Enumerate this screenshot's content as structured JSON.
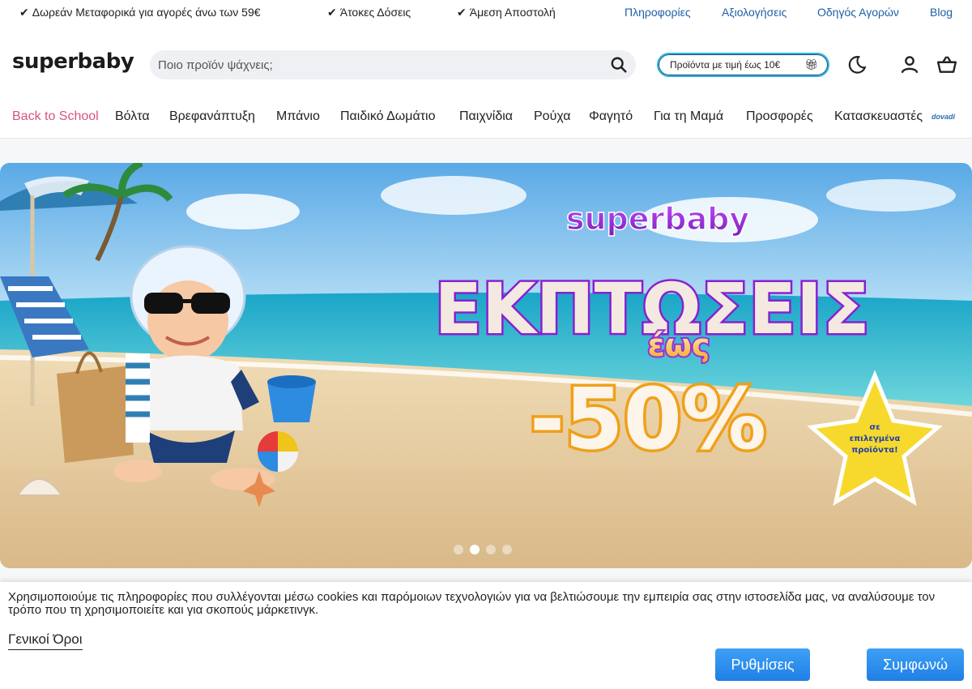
{
  "topbar": {
    "perks": [
      {
        "check": "✔",
        "label": "Δωρεάν Μεταφορικά για αγορές άνω των 59€"
      },
      {
        "check": "✔",
        "label": "Άτοκες Δόσεις"
      },
      {
        "check": "✔",
        "label": "Άμεση Αποστολή"
      }
    ],
    "links": [
      "Πληροφορίες",
      "Αξιολογήσεις",
      "Οδηγός Αγορών",
      "Blog"
    ]
  },
  "header": {
    "logo": "superbaby",
    "search_placeholder": "Ποιο προϊόν ψάχνεις;",
    "promo_label": "Προϊόντα με τιμή έως 10€",
    "icons": [
      "search-icon",
      "gift-icon",
      "moon-icon",
      "user-icon",
      "cart-icon"
    ]
  },
  "nav": {
    "items": [
      "Back to School",
      "Βόλτα",
      "Βρεφανάπτυξη",
      "Μπάνιο",
      "Παιδικό Δωμάτιο",
      "Παιχνίδια",
      "Ρούχα",
      "Φαγητό",
      "Για τη Μαμά",
      "Προσφορές",
      "Κατασκευαστές"
    ],
    "badge": "dovadi"
  },
  "hero": {
    "brand": "superbaby",
    "headline": "ΕΚΠΤΩΣΕΙΣ",
    "upto": "έως",
    "discount": "-50%",
    "star_text": [
      "σε",
      "επιλεγμένα",
      "προϊόντα!"
    ],
    "slides": 4,
    "active_slide": 2
  },
  "cookie": {
    "message": "Χρησιμοποιούμε τις πληροφορίες που συλλέγονται μέσω cookies και παρόμοιων τεχνολογιών για να βελτιώσουμε την εμπειρία σας στην ιστοσελίδα μας, να αναλύσουμε τον τρόπο που τη χρησιμοποιείτε και για σκοπούς μάρκετινγκ.",
    "terms_link": "Γενικοί Όροι",
    "settings_button": "Ρυθμίσεις",
    "accept_button": "Συμφωνώ"
  },
  "colors": {
    "link_blue": "#1f5fa6",
    "nav_accent": "#d9537c",
    "promo_border": "#27b8d4",
    "button_blue": "#1f7fe6",
    "hero_purple": "#9b2fd6"
  }
}
